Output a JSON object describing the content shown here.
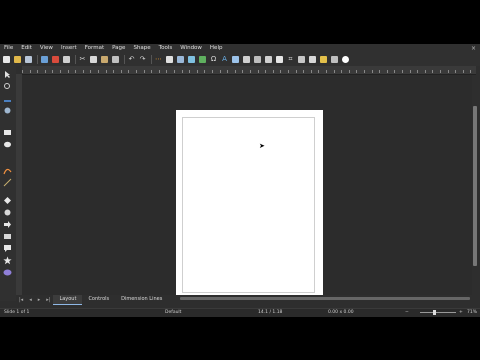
{
  "menubar": {
    "items": [
      "File",
      "Edit",
      "View",
      "Insert",
      "Format",
      "Page",
      "Shape",
      "Tools",
      "Window",
      "Help"
    ],
    "close_label": "×"
  },
  "tabs": [
    {
      "label": "Layout",
      "active": true
    },
    {
      "label": "Controls",
      "active": false
    },
    {
      "label": "Dimension Lines",
      "active": false
    }
  ],
  "statusbar": {
    "slide": "Slide 1 of 1",
    "master": "Default",
    "position": "14.1 / 1.18",
    "size": "0.00 x 0.00",
    "zoom": "71%"
  },
  "colors": {
    "accent": "#8fb8e6",
    "page": "#ffffff",
    "workspace": "#2c2c2c"
  }
}
